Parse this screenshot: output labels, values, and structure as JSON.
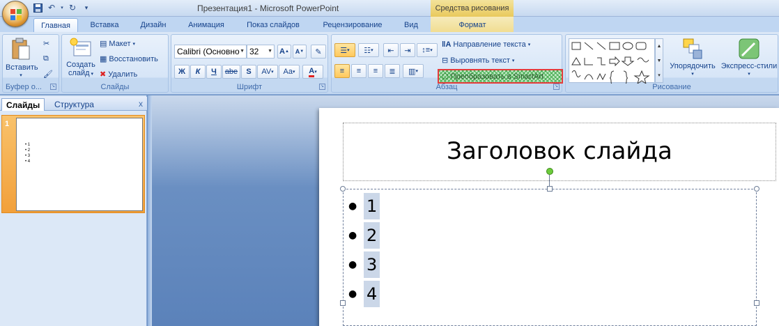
{
  "window": {
    "title": "Презентация1 - Microsoft PowerPoint",
    "context_title": "Средства рисования"
  },
  "tabs": [
    {
      "label": "Главная"
    },
    {
      "label": "Вставка"
    },
    {
      "label": "Дизайн"
    },
    {
      "label": "Анимация"
    },
    {
      "label": "Показ слайдов"
    },
    {
      "label": "Рецензирование"
    },
    {
      "label": "Вид"
    },
    {
      "label": "Формат"
    }
  ],
  "ribbon": {
    "clipboard": {
      "label": "Буфер о...",
      "paste": "Вставить"
    },
    "slides": {
      "label": "Слайды",
      "new_slide_1": "Создать",
      "new_slide_2": "слайд",
      "layout": "Макет",
      "reset": "Восстановить",
      "delete": "Удалить"
    },
    "font": {
      "label": "Шрифт",
      "font_name": "Calibri (Основно",
      "font_size": "32",
      "bold": "Ж",
      "italic": "К",
      "underline": "Ч",
      "strike": "abe",
      "shadow": "S",
      "spacing": "AV",
      "case": "Aa"
    },
    "paragraph": {
      "label": "Абзац",
      "text_direction": "Направление текста",
      "align_text": "Выровнять текст",
      "smartart": "Преобразовать в SmartArt"
    },
    "drawing": {
      "label": "Рисование",
      "arrange": "Упорядочить",
      "quick_styles": "Экспресс-стили"
    }
  },
  "left_pane": {
    "tab_slides": "Слайды",
    "tab_outline": "Структура",
    "close": "x",
    "thumb_number": "1",
    "thumb_items": [
      "1",
      "2",
      "3",
      "4"
    ]
  },
  "slide": {
    "title": "Заголовок слайда",
    "bullets": [
      "1",
      "2",
      "3",
      "4"
    ]
  },
  "colors": {
    "smartart_highlight": "#e53b3b",
    "rotation_handle": "#6ccb3c",
    "font_color": "#e02020"
  }
}
